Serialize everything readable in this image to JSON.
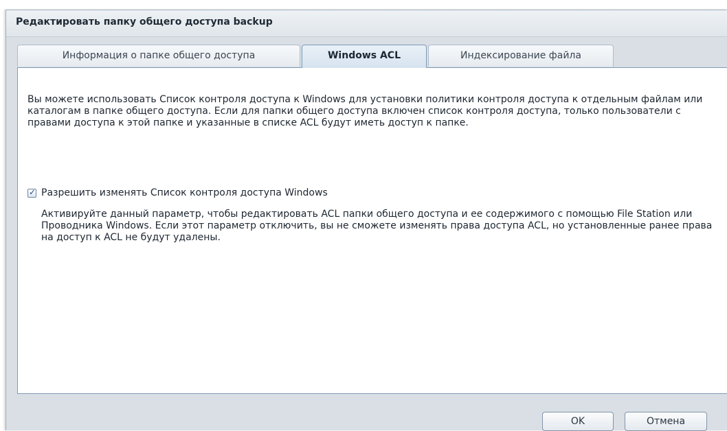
{
  "window": {
    "title": "Редактировать папку общего доступа backup"
  },
  "tabs": [
    {
      "label": "Информация о папке общего доступа",
      "active": false
    },
    {
      "label": "Windows ACL",
      "active": true
    },
    {
      "label": "Индексирование файла",
      "active": false
    }
  ],
  "content": {
    "description": "Вы можете использовать Список контроля доступа к Windows для установки политики контроля доступа к отдельным файлам или каталогам в папке общего доступа. Если для папки общего доступа включен список контроля доступа, только пользователи с правами доступа к этой папке и указанные в списке ACL будут иметь доступ к папке.",
    "acl_checkbox": {
      "label": "Разрешить изменять Список контроля доступа Windows",
      "checked": true
    },
    "hint": "Активируйте данный параметр, чтобы редактировать ACL папки общего доступа и ее содержимого с помощью File Station или Проводника Windows. Если этот параметр отключить, вы не сможете изменять права доступа ACL, но установленные ранее права на доступ к ACL не будут удалены."
  },
  "footer": {
    "ok_label": "OK",
    "cancel_label": "Отмена"
  },
  "colors": {
    "accent_border": "#7f9ab6",
    "dialog_background": "#d9dfe5",
    "checkbox_tick": "#2a4f82"
  },
  "icons": {
    "checkbox_mark": "checkmark-icon"
  }
}
